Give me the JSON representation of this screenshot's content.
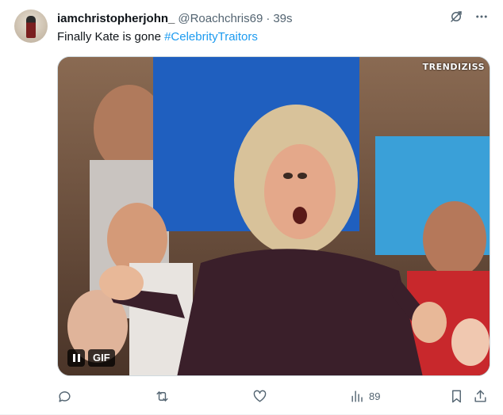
{
  "tweet": {
    "display_name": "iamchristopherjohn_",
    "handle": "@Roachchris69",
    "separator": "·",
    "time": "39s",
    "text_plain": "Finally Kate is gone ",
    "hashtag": "#CelebrityTraitors",
    "media": {
      "watermark": "TRENDIZISS",
      "gif_label": "GIF"
    },
    "actions": {
      "views_count": "89"
    }
  },
  "icons": {
    "grok": "grok-icon",
    "more": "more-icon",
    "reply": "reply-icon",
    "retweet": "retweet-icon",
    "like": "like-icon",
    "views": "views-icon",
    "bookmark": "bookmark-icon",
    "share": "share-icon",
    "pause": "pause-icon"
  },
  "colors": {
    "text": "#0f1419",
    "secondary": "#536471",
    "link": "#1d9bf0"
  }
}
